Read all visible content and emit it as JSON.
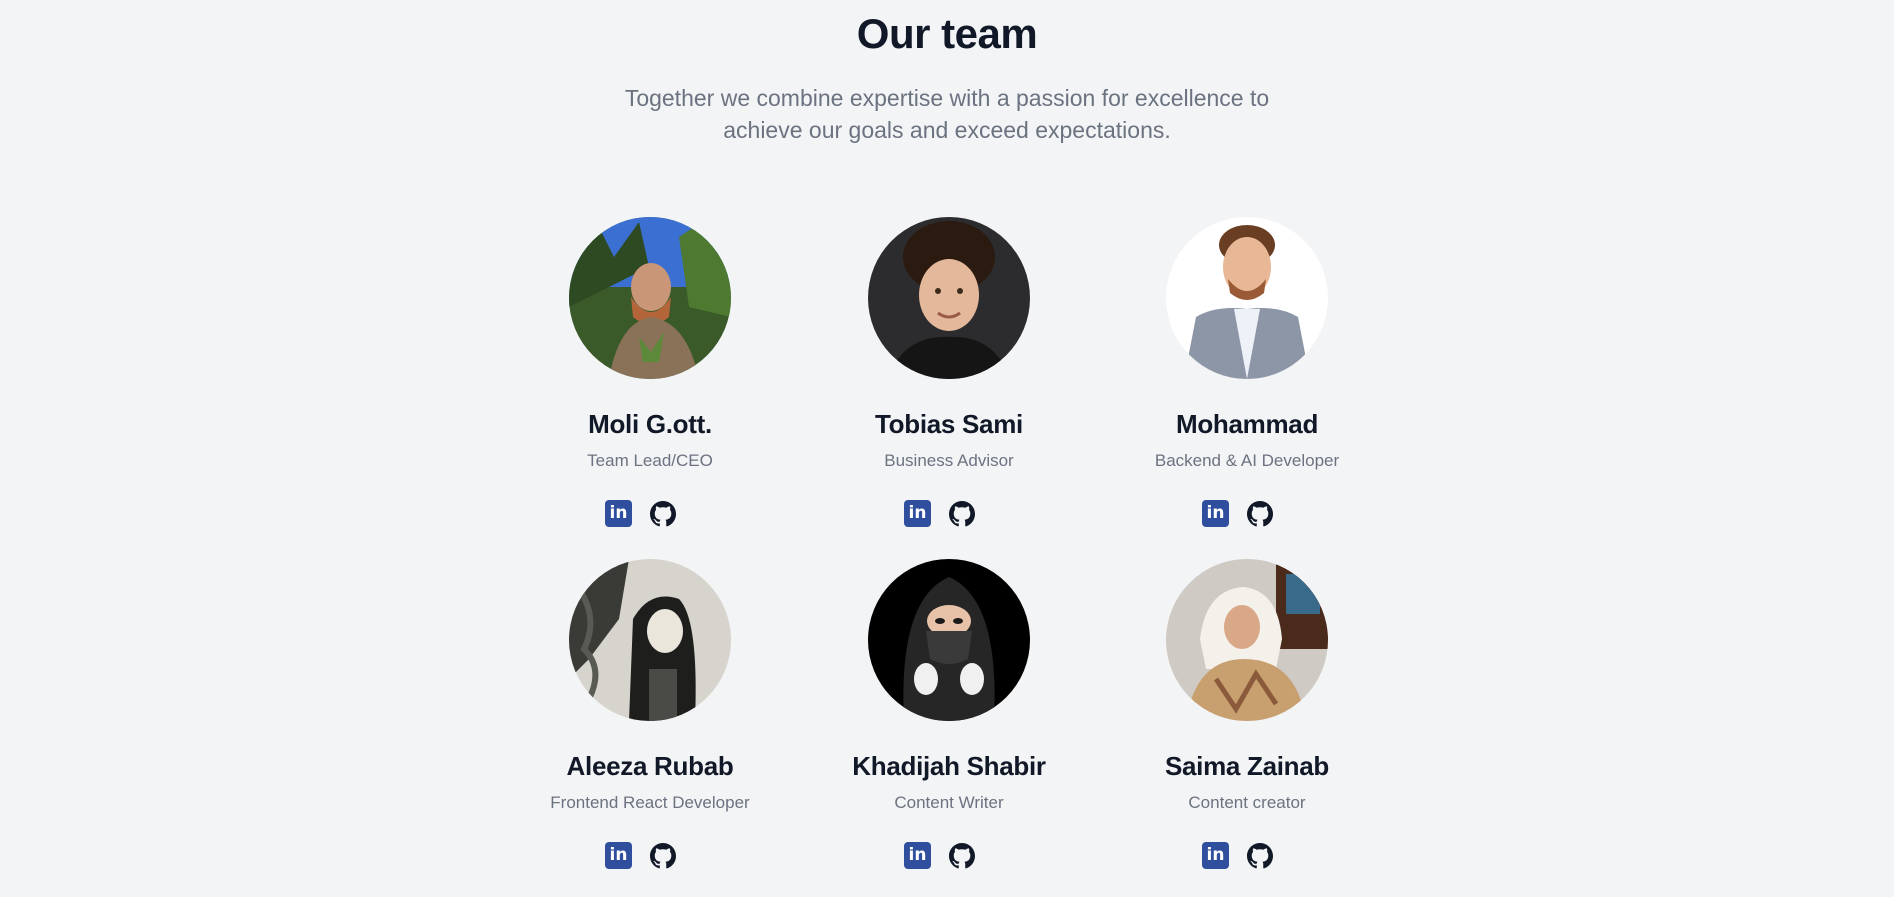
{
  "header": {
    "title": "Our team",
    "subtitle": "Together we combine expertise with a passion for excellence to achieve our goals and exceed expectations."
  },
  "team": [
    {
      "name": "Moli G.ott.",
      "role": "Team Lead/CEO"
    },
    {
      "name": "Tobias Sami",
      "role": "Business Advisor"
    },
    {
      "name": "Mohammad",
      "role": "Backend & AI Developer"
    },
    {
      "name": "Aleeza Rubab",
      "role": "Frontend React Developer"
    },
    {
      "name": "Khadijah Shabir",
      "role": "Content Writer"
    },
    {
      "name": "Saima Zainab",
      "role": "Content creator"
    }
  ],
  "social": {
    "linkedin_glyph": "in",
    "linkedin_icon": "linkedin-icon",
    "github_icon": "github-icon"
  },
  "colors": {
    "background": "#f3f4f6",
    "heading": "#111827",
    "muted": "#6b7280",
    "linkedin": "#2f4f9e"
  }
}
